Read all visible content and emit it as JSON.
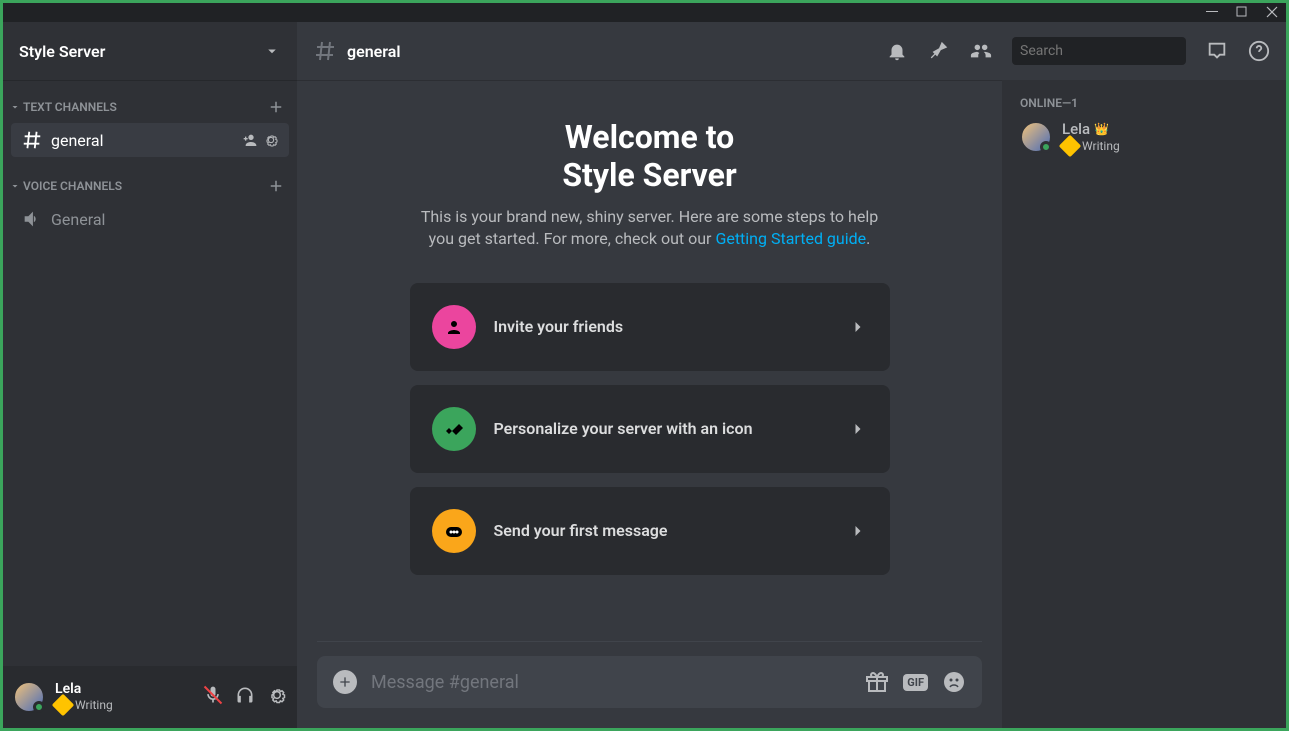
{
  "server": {
    "name": "Style Server"
  },
  "sidebar": {
    "text_channels_label": "TEXT CHANNELS",
    "voice_channels_label": "VOICE CHANNELS",
    "channels": {
      "general": "general",
      "voice_general": "General"
    }
  },
  "header": {
    "channel": "general",
    "search_placeholder": "Search"
  },
  "welcome": {
    "title_line1": "Welcome to",
    "title_line2": "Style Server",
    "subtitle_pre": "This is your brand new, shiny server. Here are some steps to help you get started. For more, check out our ",
    "link": "Getting Started guide",
    "subtitle_post": "."
  },
  "cards": {
    "invite": "Invite your friends",
    "personalize": "Personalize your server with an icon",
    "firstmsg": "Send your first message"
  },
  "message_box": {
    "placeholder": "Message #general",
    "gif": "GIF"
  },
  "members": {
    "header": "ONLINE—1",
    "lela": {
      "name": "Lela",
      "status": "Writing"
    }
  },
  "user": {
    "name": "Lela",
    "status": "Writing"
  }
}
